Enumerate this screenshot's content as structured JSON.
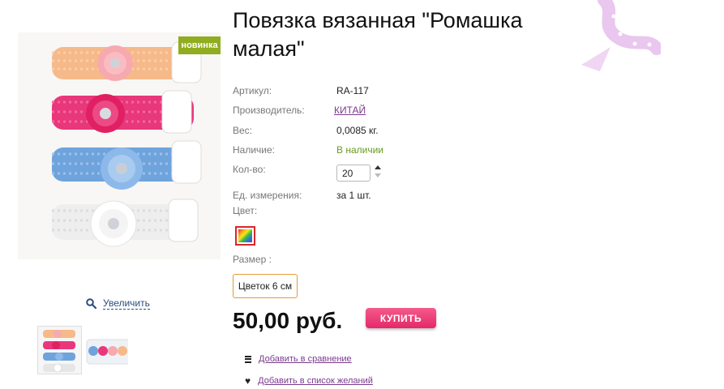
{
  "product": {
    "title": "Повязка вязанная \"Ромашка малая\"",
    "badge": "новинка",
    "zoom_label": "Увеличить"
  },
  "specs": {
    "article_label": "Артикул:",
    "article_value": "RA-117",
    "manufacturer_label": "Производитель:",
    "manufacturer_value": "КИТАЙ",
    "weight_label": "Вес:",
    "weight_value": "0,0085 кг.",
    "availability_label": "Наличие:",
    "availability_value": "В наличии",
    "qty_label": "Кол-во:",
    "qty_value": "20",
    "unit_label": "Ед. измерения:",
    "unit_value": "за 1 шт.",
    "color_label": "Цвет:",
    "size_label": "Размер :",
    "size_option": "Цветок 6 см"
  },
  "purchase": {
    "price": "50,00 руб.",
    "buy_label": "КУПИТЬ"
  },
  "actions": {
    "compare": "Добавить в сравнение",
    "wishlist": "Добавить в список желаний"
  },
  "icons": {
    "zoom": "magnifier-icon",
    "compare": "list-icon",
    "wishlist": "heart-icon"
  },
  "colors": {
    "badge": "#8fad1e",
    "buy": "#e4286a",
    "link": "#7a3a8c",
    "in_stock": "#6a9a1c",
    "size_border": "#e39a3a"
  }
}
